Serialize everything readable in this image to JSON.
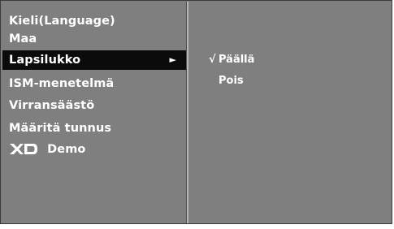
{
  "menu": {
    "items": [
      {
        "label": "Kieli(Language)"
      },
      {
        "label": "Maa"
      },
      {
        "label": "Lapsilukko",
        "selected": true,
        "has_submenu": true
      },
      {
        "label": "ISM-menetelmä"
      },
      {
        "label": "Virransäästö"
      },
      {
        "label": "Määritä tunnus"
      },
      {
        "label": "Demo",
        "icon": "xd-logo-icon"
      }
    ],
    "submenu_arrow": "►"
  },
  "submenu": {
    "options": [
      {
        "label": "Päällä",
        "checked": true,
        "check_mark": "√"
      },
      {
        "label": "Pois",
        "checked": false,
        "check_mark": ""
      }
    ]
  },
  "colors": {
    "panel_bg": "#7f7f7f",
    "selected_bg": "#0b0b0b",
    "text": "#ffffff",
    "divider": "#b9b9b9"
  }
}
